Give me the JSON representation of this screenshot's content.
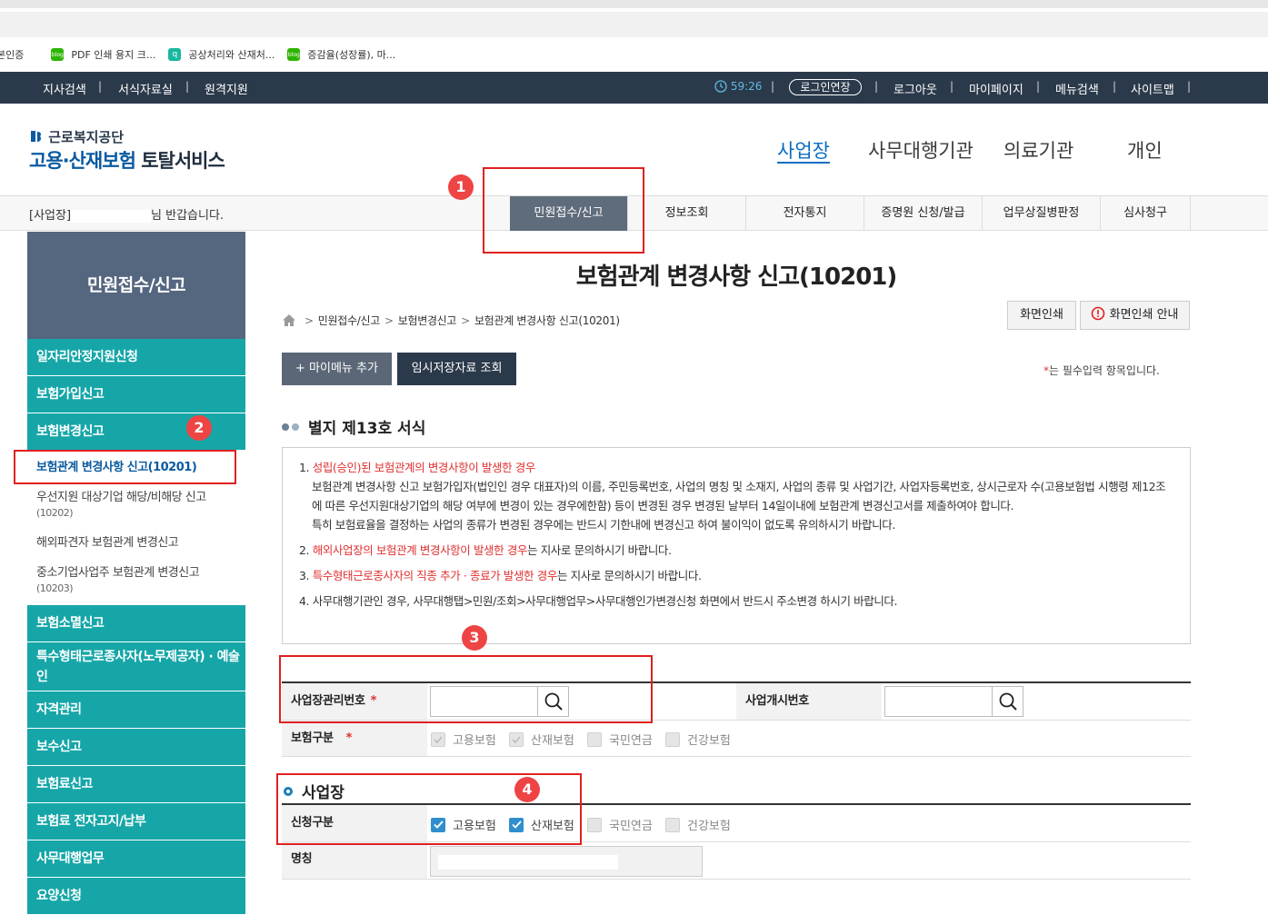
{
  "browser": {
    "bookmarks": [
      {
        "label": "본인증",
        "icon": "none"
      },
      {
        "label": "PDF 인쇄 용지 크...",
        "icon": "blog-icon"
      },
      {
        "label": "공상처리와 산재처...",
        "icon": "q-icon"
      },
      {
        "label": "증감율(성장률), 마...",
        "icon": "blog-icon"
      }
    ]
  },
  "utility": {
    "left_links": [
      "지사검색",
      "서식자료실",
      "원격지원"
    ],
    "timer": "59:26",
    "login_extend": "로그인연장",
    "right_links": [
      "로그아웃",
      "마이페이지",
      "메뉴검색",
      "사이트맵"
    ]
  },
  "header": {
    "logo_top": "근로복지공단",
    "logo_main_blue": "고용·산재보험",
    "logo_main_dark": "토탈서비스",
    "nav": [
      "사업장",
      "사무대행기관",
      "의료기관",
      "개인"
    ]
  },
  "gnb": {
    "welcome_prefix": "[사업장]",
    "welcome_suffix": "님 반갑습니다.",
    "tabs": [
      "민원접수/신고",
      "정보조회",
      "전자통지",
      "증명원 신청/발급",
      "업무상질병판정",
      "심사청구"
    ]
  },
  "sidebar": {
    "title": "민원접수/신고",
    "menu1": "일자리안정지원신청",
    "menu2": "보험가입신고",
    "menu3": "보험변경신고",
    "sub1": "보험관계 변경사항 신고(10201)",
    "sub2": "우선지원 대상기업 해당/비해당 신고",
    "sub2_code": "(10202)",
    "sub3": "해외파견자 보험관계 변경신고",
    "sub4": "중소기업사업주 보험관계 변경신고",
    "sub4_code": "(10203)",
    "menu4": "보험소멸신고",
    "menu5": "특수형태근로종사자(노무제공자) · 예술인",
    "menu6": "자격관리",
    "menu7": "보수신고",
    "menu8": "보험료신고",
    "menu9": "보험료 전자고지/납부",
    "menu10": "사무대행업무",
    "menu11": "요양신청"
  },
  "main": {
    "title": "보험관계 변경사항 신고(10201)",
    "breadcrumb": [
      "민원접수/신고",
      "보험변경신고",
      "보험관계 변경사항 신고(10201)"
    ],
    "print_btn": "화면인쇄",
    "print_guide_btn": "화면인쇄 안내",
    "add_mymenu_btn": "+ 마이메뉴 추가",
    "temp_save_btn": "임시저장자료 조회",
    "required_note_star": "*",
    "required_note": "는 필수입력 항목입니다.",
    "section_title": "별지 제13호 서식",
    "notice": {
      "n1_num": "1.",
      "n1_red": "성립(승인)된 보험관계의 변경사항이 발생한 경우",
      "n1_body": "보험관계 변경사항 신고 보험가입자(법인인 경우 대표자)의 이름, 주민등록번호, 사업의 명칭 및 소재지, 사업의 종류 및 사업기간, 사업자등록번호, 상시근로자 수(고용보험법 시행령 제12조에 따른 우선지원대상기업의 해당 여부에 변경이 있는 경우에한함) 등이 변경된 경우 변경된 날부터 14일이내에 보험관계 변경신고서를 제출하여야 합니다.",
      "n1_body2": "특히 보험료율을 결정하는 사업의 종류가 변경된 경우에는 반드시 기한내에 변경신고 하여 불이익이 없도록 유의하시기 바랍니다.",
      "n2_num": "2.",
      "n2_red": "해외사업장의 보험관계 변경사항이 발생한 경우",
      "n2_tail": "는 지사로 문의하시기 바랍니다.",
      "n3_num": "3.",
      "n3_red": "특수형태근로종사자의 직종 추가 · 종료가 발생한 경우",
      "n3_tail": "는 지사로 문의하시기 바랍니다.",
      "n4": "4. 사무대행기관인 경우, 사무대행탭>민원/조회>사무대행업무>사무대행인가변경신청 화면에서 반드시 주소변경 하시기 바랍니다."
    },
    "form": {
      "biz_mgmt_no_label": "사업장관리번호",
      "biz_open_no_label": "사업개시번호",
      "insurance_type_label": "보험구분",
      "insurance_options": [
        "고용보험",
        "산재보험",
        "국민연금",
        "건강보험"
      ],
      "section2_title": "사업장",
      "apply_type_label": "신청구분",
      "apply_options": [
        "고용보험",
        "산재보험",
        "국민연금",
        "건강보험"
      ],
      "name_label": "명칭",
      "required_star": "*"
    }
  },
  "annotations": [
    "1",
    "2",
    "3",
    "4"
  ],
  "colors": {
    "dark_bar": "#2b3a4b",
    "teal_menu": "#16a6a8",
    "active_tab": "#5f6c7b",
    "highlight_red": "#e02020",
    "link_blue": "#0a6cc0"
  }
}
